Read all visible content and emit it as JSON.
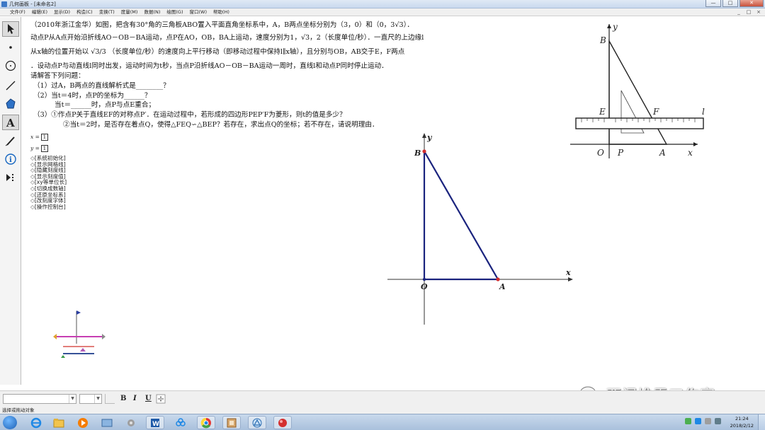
{
  "window": {
    "title": "几何画板 - [未命名2]",
    "controls": [
      "—",
      "□",
      "✕"
    ]
  },
  "menu": {
    "items": [
      "文件(F)",
      "编辑(E)",
      "显示(D)",
      "构造(C)",
      "变换(T)",
      "度量(M)",
      "数据(N)",
      "绘图(G)",
      "窗口(W)",
      "帮助(H)"
    ],
    "right_controls": [
      "_",
      "□",
      "×"
    ]
  },
  "toolbox": {
    "tools": [
      "arrow-select-tool",
      "point-tool",
      "compass-tool",
      "straightedge-tool",
      "polygon-tool",
      "text-tool",
      "marker-tool",
      "information-tool",
      "custom-tool"
    ]
  },
  "problem": {
    "line1": "（2010年浙江金华）如图，把含有30°角的三角板ABO置入平面直角坐标系中，A，B两点坐标分别为（3，0）和（0，3√3）．",
    "line2": "动点P从A点开始沿折线AO－OB－BA运动，点P在AO，OB，BA上运动，速度分别为1，√3，2（长度单位/秒）．一直尺的上边缘l",
    "line3": "从x轴的位置开始以 √3/3 （长度单位/秒）的速度向上平行移动（即移动过程中保持l∥x轴），且分别与OB，AB交于E，F两点",
    "line4": "．设动点P与动直线l同时出发，运动时间为t秒，当点P沿折线AO－OB－BA运动一周时，直线l和动点P同时停止运动．",
    "line5": "请解答下列问题：",
    "q1": "（1）过A，B两点的直线解析式是________？",
    "q2": "（2）当t＝4时，点P的坐标为______？",
    "q2b": "当t＝______时，点P与点E重合；",
    "q3": "（3）①作点P关于直线EF的对称点P′．在运动过程中，若形成的四边形PEP′F为菱形，则t的值是多少？",
    "q3b": "②当t＝2时，是否存在着点Q，使得△FEQ∽△BEP？若存在，求出点Q的坐标；若不存在，请说明理由．"
  },
  "params": {
    "x_label": "x =",
    "x_value": "1",
    "y_label": "y =",
    "y_value": "1"
  },
  "control_buttons": [
    "[系统初始化]",
    "[显示网格线]",
    "[隐藏刻度线]",
    "[显示刻度值]",
    "[xy等单位长]",
    "[切换成数轴]",
    "[还原坐标系]",
    "[改刻度字体]",
    "[操作控制台]"
  ],
  "reference_figure": {
    "labels": {
      "B": "B",
      "y": "y",
      "E": "E",
      "F": "F",
      "l": "l",
      "O": "O",
      "P": "P",
      "A": "A",
      "x": "x"
    }
  },
  "main_figure": {
    "labels": {
      "B": "B",
      "y": "y",
      "O": "O",
      "A": "A",
      "x": "x"
    },
    "colors": {
      "triangle": "#1a237e",
      "axis": "#333333",
      "point": "#d32f2f"
    }
  },
  "format_bar": {
    "bold": "B",
    "italic": "I",
    "underline": "U"
  },
  "status": {
    "text": "选择或拖动对象"
  },
  "watermark": {
    "text": "西门堆雪工作室"
  },
  "taskbar": {
    "time": "21:24",
    "date": "2018/2/12"
  }
}
